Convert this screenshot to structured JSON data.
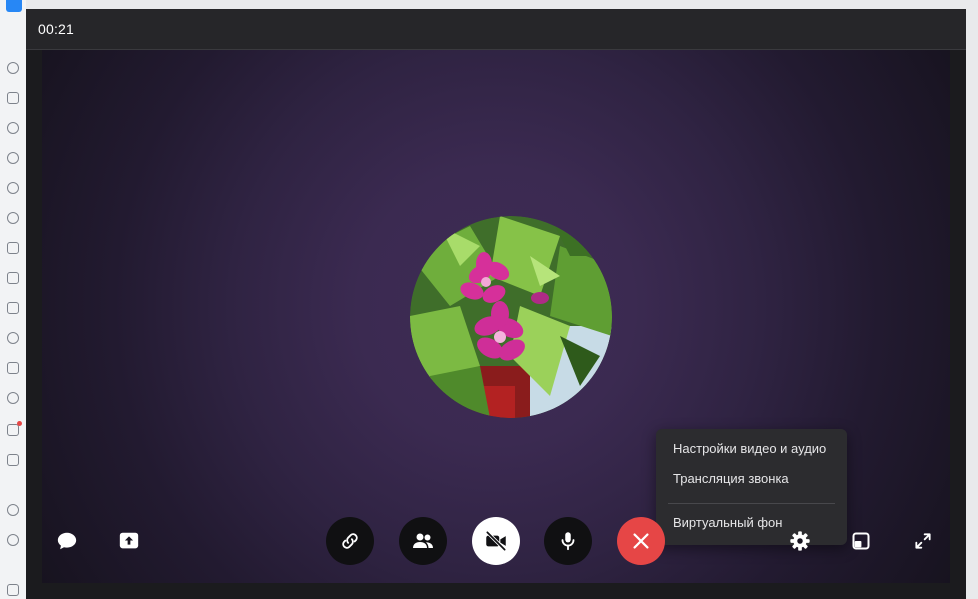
{
  "call": {
    "timer": "00:21"
  },
  "settings_menu": {
    "items": [
      {
        "label": "Настройки видео и аудио"
      },
      {
        "label": "Трансляция звонка"
      },
      {
        "label": "Виртуальный фон"
      }
    ]
  },
  "controls": {
    "left": [
      "chat-icon",
      "screen-share-icon"
    ],
    "center": [
      "link-icon",
      "participants-icon",
      "camera-off-icon",
      "microphone-icon",
      "end-call-icon"
    ],
    "right": [
      "gear-icon",
      "picture-in-picture-icon",
      "fullscreen-icon"
    ]
  },
  "colors": {
    "end_call": "#e64646",
    "camera_button": "#ffffff",
    "control_button": "#101012",
    "menu_background": "#2c2c2f",
    "stage_center": "#3e2c55"
  }
}
